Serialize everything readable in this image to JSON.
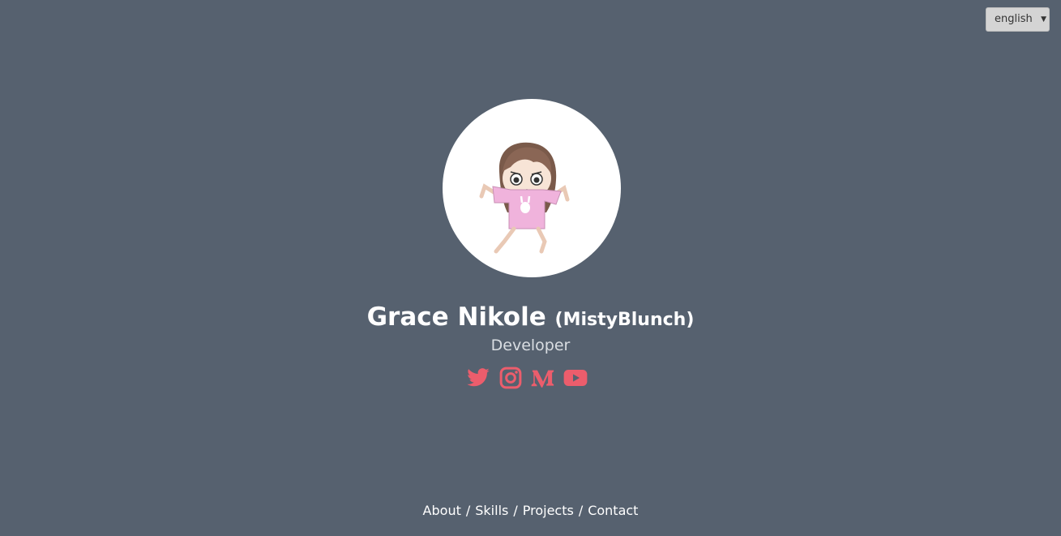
{
  "language_select": {
    "value": "english"
  },
  "profile": {
    "name": "Grace Nikole",
    "alias": "(MistyBlunch)",
    "role": "Developer"
  },
  "socials": [
    {
      "icon": "twitter-icon"
    },
    {
      "icon": "instagram-icon"
    },
    {
      "icon": "medium-icon"
    },
    {
      "icon": "youtube-icon"
    }
  ],
  "nav": {
    "about": "About",
    "skills": "Skills",
    "projects": "Projects",
    "contact": "Contact",
    "separator": "/"
  },
  "colors": {
    "background": "#56616f",
    "accent": "#ec5d6c",
    "text": "#ffffff"
  }
}
